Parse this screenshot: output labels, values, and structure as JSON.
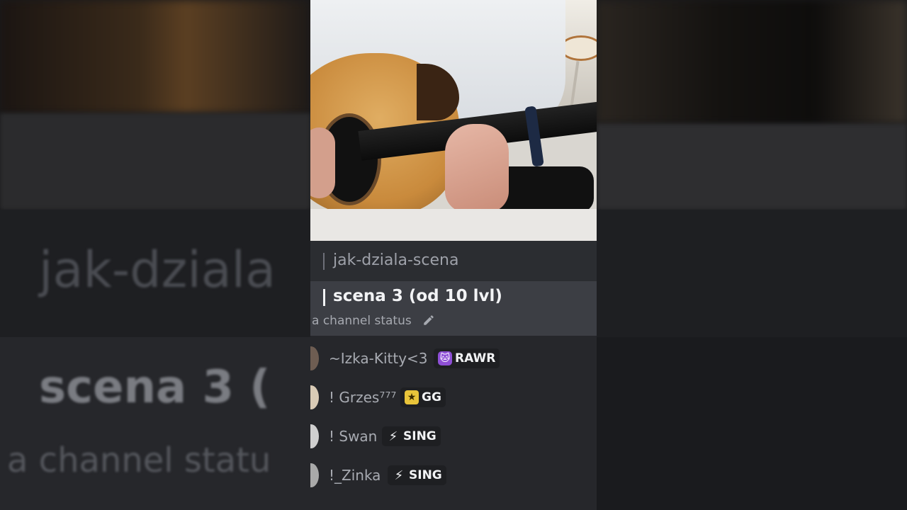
{
  "channels": [
    {
      "name": "jak-dziala-scena"
    },
    {
      "name": "scena 3 (od 10 lvl)",
      "status_placeholder": "a channel status"
    }
  ],
  "members": [
    {
      "name": "~Izka-Kitty<3",
      "tag_icon": "cat-face-icon",
      "tag": "RAWR"
    },
    {
      "name": "! Grzes⁷⁷⁷",
      "tag_icon": "gg-badge-icon",
      "tag": "GG"
    },
    {
      "name": "! Swan",
      "tag_icon": "lightning-icon",
      "tag": "SING"
    },
    {
      "name": "!_Zinka",
      "tag_icon": "lightning-icon",
      "tag": "SING"
    }
  ],
  "background_ghost_text": {
    "channel": "jak-dziala",
    "stage": "scena 3 (",
    "status": "a channel statu"
  },
  "colors": {
    "panel": "#2b2d31",
    "selected_row": "#3c3e44",
    "members_bg": "#26272b",
    "tag_bg": "#1e1f22"
  }
}
